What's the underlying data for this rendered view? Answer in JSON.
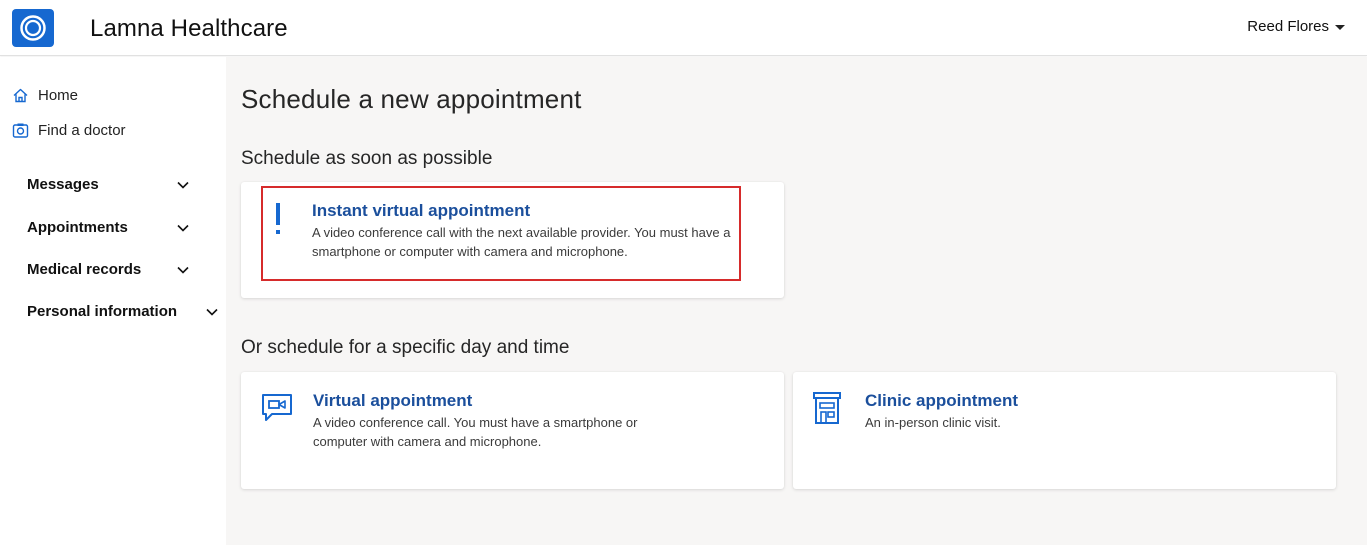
{
  "header": {
    "app_title": "Lamna Healthcare",
    "user_name": "Reed Flores",
    "logo_icon": "logo-ring-icon",
    "brand_color": "#1668d0"
  },
  "sidebar": {
    "links": [
      {
        "label": "Home",
        "icon": "home-icon"
      },
      {
        "label": "Find a doctor",
        "icon": "find-doctor-icon"
      }
    ],
    "groups": [
      {
        "label": "Messages"
      },
      {
        "label": "Appointments"
      },
      {
        "label": "Medical records"
      },
      {
        "label": "Personal information"
      }
    ]
  },
  "main": {
    "page_title": "Schedule a new appointment",
    "asap_section": {
      "title": "Schedule as soon as possible",
      "card": {
        "title": "Instant virtual appointment",
        "description": "A video conference call with the next available provider. You must have a smartphone or computer with camera and microphone.",
        "icon": "exclamation-icon",
        "highlight_color": "#d62b2b"
      }
    },
    "specific_section": {
      "title": "Or schedule for a specific day and time",
      "cards": [
        {
          "title": "Virtual appointment",
          "description": "A video conference call. You must have a smartphone or computer with camera and microphone.",
          "icon": "video-chat-icon"
        },
        {
          "title": "Clinic appointment",
          "description": "An in-person clinic visit.",
          "icon": "clinic-building-icon"
        }
      ]
    },
    "link_color": "#1b4f9c"
  }
}
